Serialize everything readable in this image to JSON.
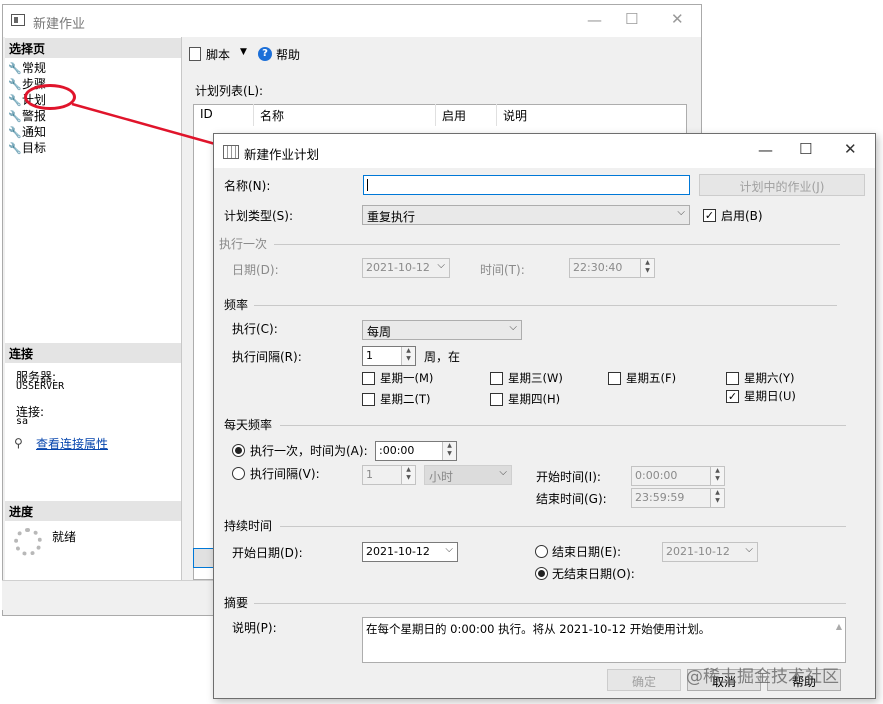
{
  "back_window": {
    "title": "新建作业",
    "select_page_header": "选择页",
    "nav_items": [
      "常规",
      "步骤",
      "计划",
      "警报",
      "通知",
      "目标"
    ],
    "toolbar": {
      "script_label": "脚本",
      "help_label": "帮助"
    },
    "schedule_list_label": "计划列表(L):",
    "columns": [
      "ID",
      "名称",
      "启用",
      "说明"
    ],
    "connection_header": "连接",
    "server_label": "服务器:",
    "server_value": "USSERVER",
    "connection_label": "连接:",
    "connection_value": "sa",
    "view_conn_props": "查看连接属性",
    "progress_header": "进度",
    "progress_status": "就绪"
  },
  "dialog": {
    "title": "新建作业计划",
    "name_label": "名称(N):",
    "name_value": "",
    "jobs_in_schedule_button": "计划中的作业(J)",
    "schedule_type_label": "计划类型(S):",
    "schedule_type_value": "重复执行",
    "enabled_label": "启用(B)",
    "enabled_checked": true,
    "one_time": {
      "group_label": "执行一次",
      "date_label": "日期(D):",
      "date_value": "2021-10-12",
      "time_label": "时间(T):",
      "time_value": "22:30:40"
    },
    "frequency": {
      "group_label": "频率",
      "occurs_label": "执行(C):",
      "occurs_value": "每周",
      "recurs_label": "执行间隔(R):",
      "recurs_value": "1",
      "recurs_suffix": "周，在",
      "days": [
        {
          "label": "星期一(M)",
          "checked": false
        },
        {
          "label": "星期二(T)",
          "checked": false
        },
        {
          "label": "星期三(W)",
          "checked": false
        },
        {
          "label": "星期四(H)",
          "checked": false
        },
        {
          "label": "星期五(F)",
          "checked": false
        },
        {
          "label": "星期六(Y)",
          "checked": false
        },
        {
          "label": "星期日(U)",
          "checked": true
        }
      ]
    },
    "daily": {
      "group_label": "每天频率",
      "once_label": "执行一次，时间为(A):",
      "once_value": ":00:00",
      "interval_label": "执行间隔(V):",
      "interval_value": "1",
      "interval_unit": "小时",
      "start_time_label": "开始时间(I):",
      "start_time_value": "0:00:00",
      "end_time_label": "结束时间(G):",
      "end_time_value": "23:59:59"
    },
    "duration": {
      "group_label": "持续时间",
      "start_date_label": "开始日期(D):",
      "start_date_value": "2021-10-12",
      "end_date_label": "结束日期(E):",
      "end_date_value": "2021-10-12",
      "no_end_label": "无结束日期(O):"
    },
    "summary": {
      "group_label": "摘要",
      "description_label": "说明(P):",
      "description_value": "在每个星期日的 0:00:00 执行。将从 2021-10-12 开始使用计划。"
    },
    "buttons": {
      "ok": "确定",
      "cancel": "取消",
      "help": "帮助"
    }
  },
  "watermark": "@稀土掘金技术社区",
  "colors": {
    "annotation": "#e0142b",
    "focus": "#0078d7",
    "link": "#0645ad"
  }
}
